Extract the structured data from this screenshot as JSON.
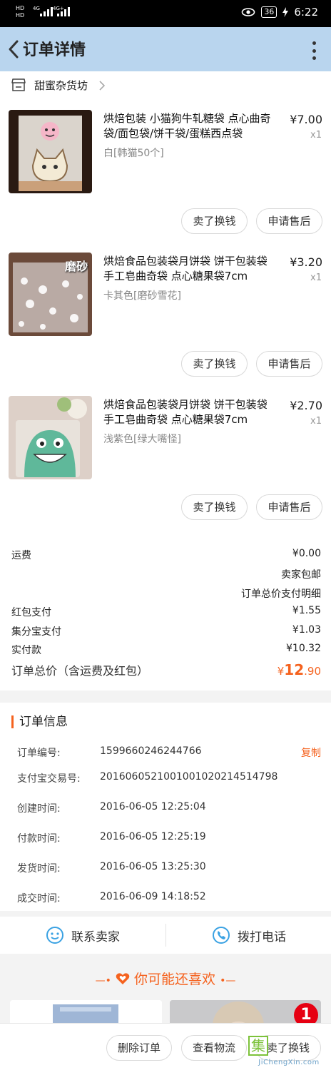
{
  "status_bar": {
    "signal_labels": [
      "HD",
      "4G",
      "4G+",
      "HD"
    ],
    "battery": "36",
    "time": "6:22"
  },
  "header": {
    "title": "订单详情"
  },
  "shop": {
    "name": "甜蜜杂货坊"
  },
  "items": [
    {
      "name": "烘焙包装 小猫狗牛轧糖袋 点心曲奇袋/面包袋/饼干袋/蛋糕西点袋",
      "variant": "白[韩猫50个]",
      "price": "¥7.00",
      "qty": "x1",
      "sell_label": "卖了换钱",
      "aftersale_label": "申请售后"
    },
    {
      "name": "烘焙食品包装袋月饼袋 饼干包装袋 手工皂曲奇袋 点心糖果袋7cm",
      "variant": "卡其色[磨砂雪花]",
      "price": "¥3.20",
      "qty": "x1",
      "sell_label": "卖了换钱",
      "aftersale_label": "申请售后",
      "thumb_text": "磨砂"
    },
    {
      "name": "烘焙食品包装袋月饼袋 饼干包装袋 手工皂曲奇袋 点心糖果袋7cm",
      "variant": "浅紫色[绿大嘴怪]",
      "price": "¥2.70",
      "qty": "x1",
      "sell_label": "卖了换钱",
      "aftersale_label": "申请售后"
    }
  ],
  "summary": {
    "shipping_label": "运费",
    "shipping_value": "¥0.00",
    "free_shipping": "卖家包邮",
    "payment_detail": "订单总价支付明细",
    "redpacket_label": "红包支付",
    "redpacket_value": "¥1.55",
    "jifenbao_label": "集分宝支付",
    "jifenbao_value": "¥1.03",
    "paid_label": "实付款",
    "paid_value": "¥10.32",
    "total_label": "订单总价（含运费及红包）",
    "total_currency": "¥",
    "total_int": "12",
    "total_dec": ".90"
  },
  "order_info": {
    "title": "订单信息",
    "rows": [
      {
        "label": "订单编号:",
        "value": "1599660246244766"
      },
      {
        "label": "支付宝交易号:",
        "value": "2016060521001001020214514798"
      },
      {
        "label": "创建时间:",
        "value": "2016-06-05 12:25:04"
      },
      {
        "label": "付款时间:",
        "value": "2016-06-05 12:25:19"
      },
      {
        "label": "发货时间:",
        "value": "2016-06-05 13:25:30"
      },
      {
        "label": "成交时间:",
        "value": "2016-06-09 14:18:52"
      }
    ],
    "copy_label": "复制"
  },
  "contact": {
    "seller_label": "联系卖家",
    "phone_label": "拨打电话"
  },
  "recommend": {
    "title": "你可能还喜欢",
    "badge": "1"
  },
  "bottom_bar": {
    "delete_label": "删除订单",
    "logistics_label": "查看物流",
    "sell_label": "卖了换钱"
  },
  "watermark": {
    "char": "集",
    "text": "JiChengXin.com"
  },
  "colors": {
    "accent": "#f5621e",
    "header_bg": "#b9d5ee"
  }
}
